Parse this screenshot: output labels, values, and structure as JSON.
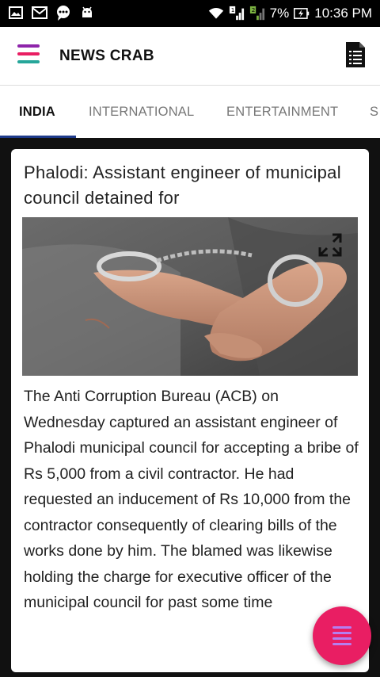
{
  "status_bar": {
    "icons": [
      "image-icon",
      "email-icon",
      "chat-icon",
      "android-icon",
      "wifi-icon",
      "signal-sim1-icon",
      "signal-sim2-icon",
      "battery-icon"
    ],
    "battery": "7%",
    "time": "10:36 PM"
  },
  "app_bar": {
    "title": "NEWS CRAB",
    "menu_colors": [
      "#8e24aa",
      "#e91e63",
      "#26a69a"
    ]
  },
  "tabs": [
    {
      "label": "INDIA",
      "active": true
    },
    {
      "label": "INTERNATIONAL",
      "active": false
    },
    {
      "label": "ENTERTAINMENT",
      "active": false
    },
    {
      "label": "S",
      "active": false
    }
  ],
  "article": {
    "headline": "Phalodi: Assistant engineer of municipal council detained for",
    "image_subject": "handcuffed hands",
    "body": "The Anti Corruption Bureau (ACB) on Wednesday captured an assistant engineer of Phalodi municipal council for accepting a bribe of Rs 5,000 from a civil contractor. He had requested an inducement of Rs 10,000 from the contractor consequently of clearing bills of the works done by him. The blamed was likewise holding the charge for executive officer of the municipal council for past some time"
  },
  "fab": {
    "icon": "menu-icon",
    "color": "#e91e63"
  }
}
